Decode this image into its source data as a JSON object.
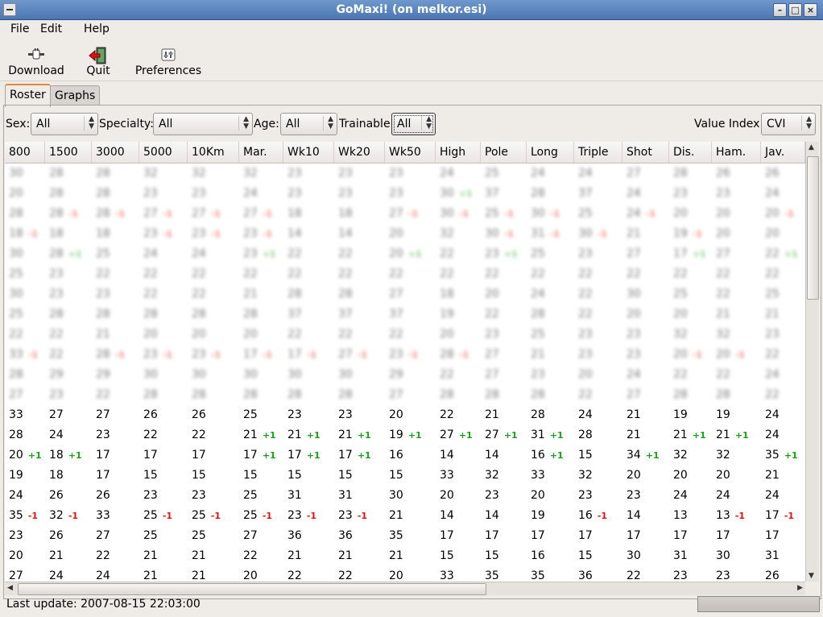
{
  "window": {
    "title": "GoMaxi! (on melkor.esi)"
  },
  "menu": {
    "file": "File",
    "edit": "Edit",
    "help": "Help"
  },
  "toolbar": {
    "download": "Download",
    "quit": "Quit",
    "preferences": "Preferences"
  },
  "tabs": {
    "roster": "Roster",
    "graphs": "Graphs"
  },
  "filters": {
    "sex_label": "Sex:",
    "sex_value": "All",
    "specialty_label": "Specialty:",
    "specialty_value": "All",
    "age_label": "Age:",
    "age_value": "All",
    "trainable_label": "Trainable:",
    "trainable_value": "All",
    "value_index_label": "Value Index:",
    "value_index_value": "CVI"
  },
  "columns": [
    "800",
    "1500",
    "3000",
    "5000",
    "10Km",
    "Mar.",
    "Wk10",
    "Wk20",
    "Wk50",
    "High",
    "Pole",
    "Long",
    "Triple",
    "Shot",
    "Dis.",
    "Ham.",
    "Jav."
  ],
  "blurred_rows": [
    [
      [
        "30",
        ""
      ],
      [
        "28",
        ""
      ],
      [
        "28",
        ""
      ],
      [
        "32",
        ""
      ],
      [
        "32",
        ""
      ],
      [
        "32",
        ""
      ],
      [
        "23",
        ""
      ],
      [
        "23",
        ""
      ],
      [
        "23",
        ""
      ],
      [
        "24",
        ""
      ],
      [
        "25",
        ""
      ],
      [
        "24",
        ""
      ],
      [
        "24",
        ""
      ],
      [
        "27",
        ""
      ],
      [
        "28",
        ""
      ],
      [
        "26",
        ""
      ],
      [
        "26",
        ""
      ]
    ],
    [
      [
        "20",
        ""
      ],
      [
        "28",
        ""
      ],
      [
        "28",
        ""
      ],
      [
        "23",
        ""
      ],
      [
        "23",
        ""
      ],
      [
        "24",
        ""
      ],
      [
        "23",
        ""
      ],
      [
        "23",
        ""
      ],
      [
        "23",
        ""
      ],
      [
        "30",
        "+1"
      ],
      [
        "37",
        ""
      ],
      [
        "28",
        ""
      ],
      [
        "37",
        ""
      ],
      [
        "24",
        ""
      ],
      [
        "23",
        ""
      ],
      [
        "23",
        ""
      ],
      [
        "24",
        ""
      ]
    ],
    [
      [
        "28",
        ""
      ],
      [
        "28",
        "-1"
      ],
      [
        "28",
        "-1"
      ],
      [
        "27",
        "-1"
      ],
      [
        "27",
        "-1"
      ],
      [
        "27",
        "-1"
      ],
      [
        "18",
        ""
      ],
      [
        "18",
        ""
      ],
      [
        "27",
        "-1"
      ],
      [
        "30",
        "-1"
      ],
      [
        "25",
        "-1"
      ],
      [
        "30",
        "-1"
      ],
      [
        "25",
        ""
      ],
      [
        "24",
        "-1"
      ],
      [
        "20",
        ""
      ],
      [
        "20",
        ""
      ],
      [
        "20",
        "-1"
      ]
    ],
    [
      [
        "18",
        "-1"
      ],
      [
        "18",
        ""
      ],
      [
        "18",
        ""
      ],
      [
        "23",
        "-1"
      ],
      [
        "23",
        "-1"
      ],
      [
        "23",
        "-1"
      ],
      [
        "14",
        ""
      ],
      [
        "14",
        ""
      ],
      [
        "20",
        ""
      ],
      [
        "32",
        ""
      ],
      [
        "30",
        "-1"
      ],
      [
        "31",
        "-1"
      ],
      [
        "30",
        "-1"
      ],
      [
        "21",
        ""
      ],
      [
        "19",
        "-1"
      ],
      [
        "20",
        ""
      ],
      [
        "20",
        ""
      ]
    ],
    [
      [
        "30",
        ""
      ],
      [
        "28",
        "+1"
      ],
      [
        "25",
        ""
      ],
      [
        "24",
        ""
      ],
      [
        "24",
        ""
      ],
      [
        "23",
        "+1"
      ],
      [
        "22",
        ""
      ],
      [
        "22",
        ""
      ],
      [
        "20",
        "+1"
      ],
      [
        "22",
        ""
      ],
      [
        "23",
        "+1"
      ],
      [
        "25",
        ""
      ],
      [
        "23",
        ""
      ],
      [
        "27",
        ""
      ],
      [
        "17",
        "+1"
      ],
      [
        "27",
        ""
      ],
      [
        "22",
        "+1"
      ]
    ],
    [
      [
        "25",
        ""
      ],
      [
        "23",
        ""
      ],
      [
        "22",
        ""
      ],
      [
        "22",
        ""
      ],
      [
        "22",
        ""
      ],
      [
        "22",
        ""
      ],
      [
        "22",
        ""
      ],
      [
        "22",
        ""
      ],
      [
        "22",
        ""
      ],
      [
        "22",
        ""
      ],
      [
        "22",
        ""
      ],
      [
        "22",
        ""
      ],
      [
        "22",
        ""
      ],
      [
        "22",
        ""
      ],
      [
        "22",
        ""
      ],
      [
        "22",
        ""
      ],
      [
        "22",
        ""
      ]
    ],
    [
      [
        "30",
        ""
      ],
      [
        "23",
        ""
      ],
      [
        "23",
        ""
      ],
      [
        "22",
        ""
      ],
      [
        "22",
        ""
      ],
      [
        "21",
        ""
      ],
      [
        "28",
        ""
      ],
      [
        "28",
        ""
      ],
      [
        "27",
        ""
      ],
      [
        "18",
        ""
      ],
      [
        "20",
        ""
      ],
      [
        "24",
        ""
      ],
      [
        "22",
        ""
      ],
      [
        "30",
        ""
      ],
      [
        "25",
        ""
      ],
      [
        "22",
        ""
      ],
      [
        "25",
        ""
      ]
    ],
    [
      [
        "25",
        ""
      ],
      [
        "28",
        ""
      ],
      [
        "28",
        ""
      ],
      [
        "28",
        ""
      ],
      [
        "28",
        ""
      ],
      [
        "28",
        ""
      ],
      [
        "37",
        ""
      ],
      [
        "37",
        ""
      ],
      [
        "37",
        ""
      ],
      [
        "19",
        ""
      ],
      [
        "22",
        ""
      ],
      [
        "28",
        ""
      ],
      [
        "22",
        ""
      ],
      [
        "20",
        ""
      ],
      [
        "20",
        ""
      ],
      [
        "21",
        ""
      ],
      [
        "21",
        ""
      ]
    ],
    [
      [
        "22",
        ""
      ],
      [
        "22",
        ""
      ],
      [
        "21",
        ""
      ],
      [
        "20",
        ""
      ],
      [
        "20",
        ""
      ],
      [
        "20",
        ""
      ],
      [
        "22",
        ""
      ],
      [
        "22",
        ""
      ],
      [
        "22",
        ""
      ],
      [
        "20",
        ""
      ],
      [
        "23",
        ""
      ],
      [
        "25",
        ""
      ],
      [
        "23",
        ""
      ],
      [
        "23",
        ""
      ],
      [
        "32",
        ""
      ],
      [
        "32",
        ""
      ],
      [
        "23",
        ""
      ]
    ],
    [
      [
        "33",
        "-1"
      ],
      [
        "22",
        ""
      ],
      [
        "28",
        "-1"
      ],
      [
        "23",
        "-1"
      ],
      [
        "23",
        "-1"
      ],
      [
        "17",
        "-1"
      ],
      [
        "17",
        "-1"
      ],
      [
        "27",
        "-1"
      ],
      [
        "23",
        "-1"
      ],
      [
        "28",
        "-1"
      ],
      [
        "27",
        ""
      ],
      [
        "21",
        ""
      ],
      [
        "23",
        ""
      ],
      [
        "23",
        ""
      ],
      [
        "20",
        "-1"
      ],
      [
        "20",
        "-1"
      ],
      [
        "22",
        ""
      ]
    ],
    [
      [
        "28",
        ""
      ],
      [
        "29",
        ""
      ],
      [
        "29",
        ""
      ],
      [
        "30",
        ""
      ],
      [
        "30",
        ""
      ],
      [
        "30",
        ""
      ],
      [
        "30",
        ""
      ],
      [
        "30",
        ""
      ],
      [
        "29",
        ""
      ],
      [
        "22",
        ""
      ],
      [
        "27",
        ""
      ],
      [
        "23",
        ""
      ],
      [
        "20",
        ""
      ],
      [
        "24",
        ""
      ],
      [
        "22",
        ""
      ],
      [
        "22",
        ""
      ],
      [
        "24",
        ""
      ]
    ],
    [
      [
        "27",
        ""
      ],
      [
        "23",
        ""
      ],
      [
        "22",
        ""
      ],
      [
        "28",
        ""
      ],
      [
        "28",
        ""
      ],
      [
        "28",
        ""
      ],
      [
        "28",
        ""
      ],
      [
        "28",
        ""
      ],
      [
        "27",
        ""
      ],
      [
        "28",
        ""
      ],
      [
        "28",
        ""
      ],
      [
        "28",
        ""
      ],
      [
        "22",
        ""
      ],
      [
        "27",
        ""
      ],
      [
        "28",
        ""
      ],
      [
        "28",
        ""
      ],
      [
        "22",
        ""
      ]
    ]
  ],
  "rows": [
    [
      [
        "33",
        ""
      ],
      [
        "27",
        ""
      ],
      [
        "27",
        ""
      ],
      [
        "26",
        ""
      ],
      [
        "26",
        ""
      ],
      [
        "25",
        ""
      ],
      [
        "23",
        ""
      ],
      [
        "23",
        ""
      ],
      [
        "20",
        ""
      ],
      [
        "22",
        ""
      ],
      [
        "21",
        ""
      ],
      [
        "28",
        ""
      ],
      [
        "24",
        ""
      ],
      [
        "21",
        ""
      ],
      [
        "19",
        ""
      ],
      [
        "19",
        ""
      ],
      [
        "24",
        ""
      ]
    ],
    [
      [
        "28",
        ""
      ],
      [
        "24",
        ""
      ],
      [
        "23",
        ""
      ],
      [
        "22",
        ""
      ],
      [
        "22",
        ""
      ],
      [
        "21",
        "+1"
      ],
      [
        "21",
        "+1"
      ],
      [
        "21",
        "+1"
      ],
      [
        "19",
        "+1"
      ],
      [
        "27",
        "+1"
      ],
      [
        "27",
        "+1"
      ],
      [
        "31",
        "+1"
      ],
      [
        "28",
        ""
      ],
      [
        "21",
        ""
      ],
      [
        "21",
        "+1"
      ],
      [
        "21",
        "+1"
      ],
      [
        "24",
        ""
      ]
    ],
    [
      [
        "20",
        "+1"
      ],
      [
        "18",
        "+1"
      ],
      [
        "17",
        ""
      ],
      [
        "17",
        ""
      ],
      [
        "17",
        ""
      ],
      [
        "17",
        "+1"
      ],
      [
        "17",
        "+1"
      ],
      [
        "17",
        "+1"
      ],
      [
        "16",
        ""
      ],
      [
        "14",
        ""
      ],
      [
        "14",
        ""
      ],
      [
        "16",
        "+1"
      ],
      [
        "15",
        ""
      ],
      [
        "34",
        "+1"
      ],
      [
        "32",
        ""
      ],
      [
        "32",
        ""
      ],
      [
        "35",
        "+1"
      ]
    ],
    [
      [
        "19",
        ""
      ],
      [
        "18",
        ""
      ],
      [
        "17",
        ""
      ],
      [
        "15",
        ""
      ],
      [
        "15",
        ""
      ],
      [
        "15",
        ""
      ],
      [
        "15",
        ""
      ],
      [
        "15",
        ""
      ],
      [
        "15",
        ""
      ],
      [
        "33",
        ""
      ],
      [
        "32",
        ""
      ],
      [
        "33",
        ""
      ],
      [
        "32",
        ""
      ],
      [
        "20",
        ""
      ],
      [
        "20",
        ""
      ],
      [
        "20",
        ""
      ],
      [
        "21",
        ""
      ]
    ],
    [
      [
        "24",
        ""
      ],
      [
        "26",
        ""
      ],
      [
        "26",
        ""
      ],
      [
        "23",
        ""
      ],
      [
        "23",
        ""
      ],
      [
        "25",
        ""
      ],
      [
        "31",
        ""
      ],
      [
        "31",
        ""
      ],
      [
        "30",
        ""
      ],
      [
        "20",
        ""
      ],
      [
        "23",
        ""
      ],
      [
        "20",
        ""
      ],
      [
        "23",
        ""
      ],
      [
        "23",
        ""
      ],
      [
        "24",
        ""
      ],
      [
        "24",
        ""
      ],
      [
        "24",
        ""
      ]
    ],
    [
      [
        "35",
        "-1"
      ],
      [
        "32",
        "-1"
      ],
      [
        "33",
        ""
      ],
      [
        "25",
        "-1"
      ],
      [
        "25",
        "-1"
      ],
      [
        "25",
        "-1"
      ],
      [
        "23",
        "-1"
      ],
      [
        "23",
        "-1"
      ],
      [
        "21",
        ""
      ],
      [
        "14",
        ""
      ],
      [
        "14",
        ""
      ],
      [
        "19",
        ""
      ],
      [
        "16",
        "-1"
      ],
      [
        "14",
        ""
      ],
      [
        "13",
        ""
      ],
      [
        "13",
        "-1"
      ],
      [
        "17",
        "-1"
      ]
    ],
    [
      [
        "23",
        ""
      ],
      [
        "26",
        ""
      ],
      [
        "27",
        ""
      ],
      [
        "25",
        ""
      ],
      [
        "25",
        ""
      ],
      [
        "27",
        ""
      ],
      [
        "36",
        ""
      ],
      [
        "36",
        ""
      ],
      [
        "35",
        ""
      ],
      [
        "17",
        ""
      ],
      [
        "17",
        ""
      ],
      [
        "17",
        ""
      ],
      [
        "17",
        ""
      ],
      [
        "17",
        ""
      ],
      [
        "17",
        ""
      ],
      [
        "17",
        ""
      ],
      [
        "17",
        ""
      ]
    ],
    [
      [
        "20",
        ""
      ],
      [
        "21",
        ""
      ],
      [
        "22",
        ""
      ],
      [
        "21",
        ""
      ],
      [
        "21",
        ""
      ],
      [
        "22",
        ""
      ],
      [
        "21",
        ""
      ],
      [
        "21",
        ""
      ],
      [
        "21",
        ""
      ],
      [
        "15",
        ""
      ],
      [
        "15",
        ""
      ],
      [
        "16",
        ""
      ],
      [
        "15",
        ""
      ],
      [
        "30",
        ""
      ],
      [
        "31",
        ""
      ],
      [
        "30",
        ""
      ],
      [
        "31",
        ""
      ]
    ],
    [
      [
        "27",
        ""
      ],
      [
        "24",
        ""
      ],
      [
        "24",
        ""
      ],
      [
        "21",
        ""
      ],
      [
        "21",
        ""
      ],
      [
        "20",
        ""
      ],
      [
        "22",
        ""
      ],
      [
        "22",
        ""
      ],
      [
        "20",
        ""
      ],
      [
        "33",
        ""
      ],
      [
        "35",
        ""
      ],
      [
        "35",
        ""
      ],
      [
        "36",
        ""
      ],
      [
        "22",
        ""
      ],
      [
        "23",
        ""
      ],
      [
        "23",
        ""
      ],
      [
        "26",
        ""
      ]
    ]
  ],
  "status": {
    "text": "Last update: 2007-08-15 22:03:00"
  }
}
